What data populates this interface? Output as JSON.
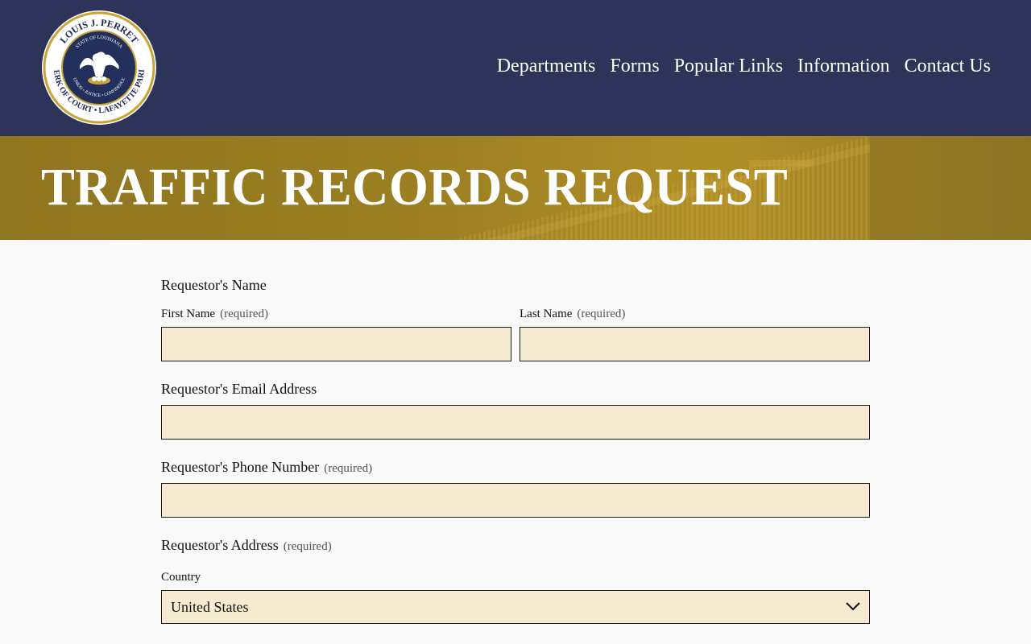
{
  "header": {
    "logo_text": {
      "outer_top": "LOUIS J. PERRET",
      "inner_top": "STATE OF LOUISIANA",
      "outer_bottom": "CLERK OF COURT • LAFAYETTE PARISH",
      "motto": "UNION • JUSTICE • CONFIDENCE"
    },
    "nav": [
      "Departments",
      "Forms",
      "Popular Links",
      "Information",
      "Contact Us"
    ]
  },
  "banner": {
    "title": "TRAFFIC RECORDS REQUEST"
  },
  "form": {
    "name_section": "Requestor's Name",
    "first_name_label": "First Name",
    "last_name_label": "Last Name",
    "required_note": "(required)",
    "first_name_value": "",
    "last_name_value": "",
    "email_label": "Requestor's Email Address",
    "email_value": "",
    "phone_label": "Requestor's Phone Number",
    "phone_value": "",
    "address_label": "Requestor's Address",
    "country_label": "Country",
    "country_value": "United States"
  },
  "colors": {
    "header_bg": "#2d3359",
    "banner_gold": "#9b7f22",
    "field_bg": "#f5ebd0"
  }
}
